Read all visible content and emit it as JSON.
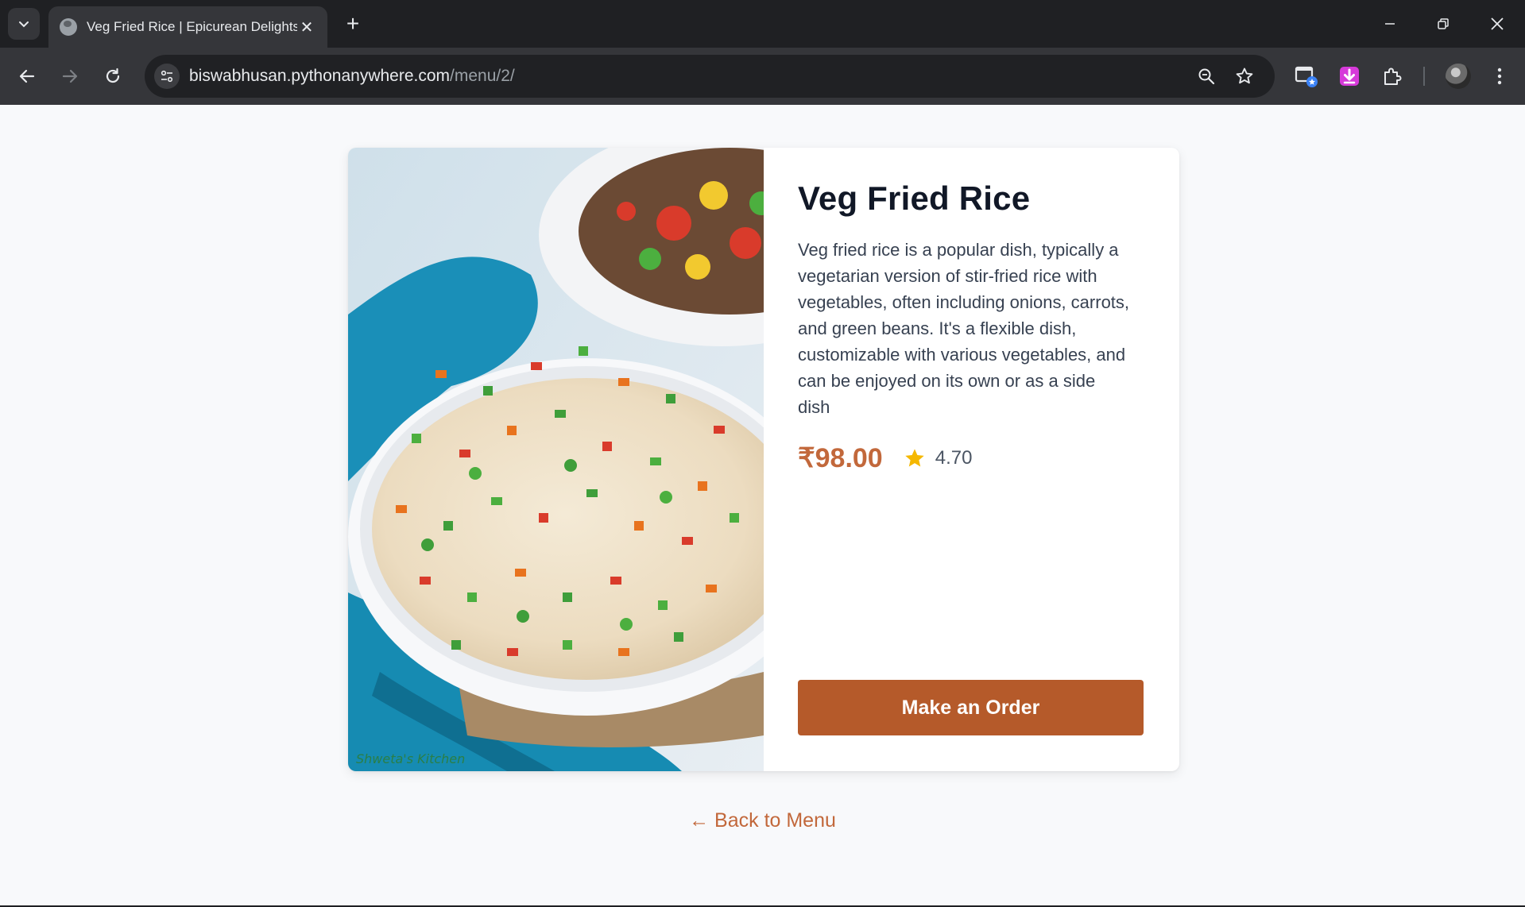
{
  "browser": {
    "tab_title": "Veg Fried Rice | Epicurean Delights",
    "url_host": "biswabhusan.pythonanywhere.com",
    "url_path": "/menu/2/",
    "new_tab_label": "+",
    "tab_close_label": "✕"
  },
  "dish": {
    "name": "Veg Fried Rice",
    "description": "Veg fried rice is a popular dish, typically a vegetarian version of stir-fried rice with vegetables, often including onions, carrots, and green beans. It's a flexible dish, customizable with various vegetables, and can be enjoyed on its own or as a side dish",
    "price": "₹98.00",
    "rating": "4.70",
    "image_watermark": "Shweta's Kitchen"
  },
  "actions": {
    "order_label": "Make an Order",
    "back_label": "← Back to Menu"
  },
  "colors": {
    "accent": "#c2683b",
    "button": "#b55a2a",
    "star": "#f5b800",
    "chrome_dark": "#1f2023",
    "chrome_toolbar": "#35363a"
  },
  "icons": [
    "tab-search-icon",
    "globe-icon",
    "close-icon",
    "plus-icon",
    "minimize-icon",
    "restore-icon",
    "window-close-icon",
    "back-arrow-icon",
    "forward-arrow-icon",
    "reload-icon",
    "site-settings-icon",
    "zoom-icon",
    "bookmark-star-icon",
    "cast-icon",
    "download-extension-icon",
    "extensions-puzzle-icon",
    "profile-avatar",
    "kebab-menu-icon",
    "rating-star-icon"
  ]
}
